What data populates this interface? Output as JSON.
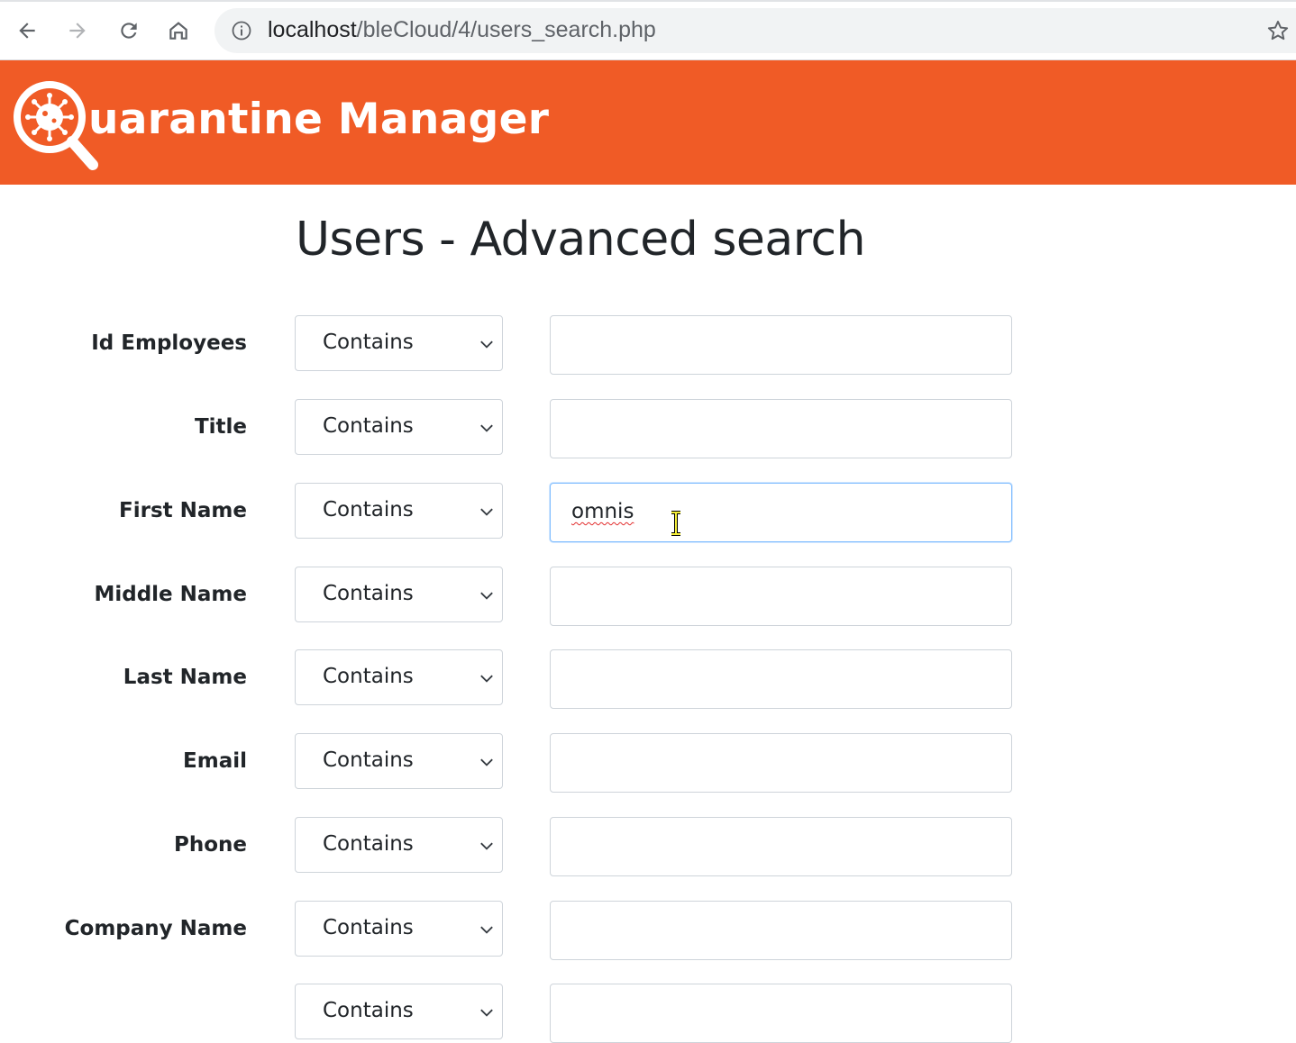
{
  "browser": {
    "url_host": "localhost",
    "url_path": "/bleCloud/4/users_search.php"
  },
  "header": {
    "app_name": "uarantine Manager",
    "brand_color": "#f05b26"
  },
  "page": {
    "title": "Users - Advanced search"
  },
  "form": {
    "rows": [
      {
        "label": "Id Employees",
        "operator": "Contains",
        "value": ""
      },
      {
        "label": "Title",
        "operator": "Contains",
        "value": ""
      },
      {
        "label": "First Name",
        "operator": "Contains",
        "value": "omnis"
      },
      {
        "label": "Middle Name",
        "operator": "Contains",
        "value": ""
      },
      {
        "label": "Last Name",
        "operator": "Contains",
        "value": ""
      },
      {
        "label": "Email",
        "operator": "Contains",
        "value": ""
      },
      {
        "label": "Phone",
        "operator": "Contains",
        "value": ""
      },
      {
        "label": "Company Name",
        "operator": "Contains",
        "value": ""
      },
      {
        "label": "",
        "operator": "Contains",
        "value": ""
      }
    ]
  }
}
